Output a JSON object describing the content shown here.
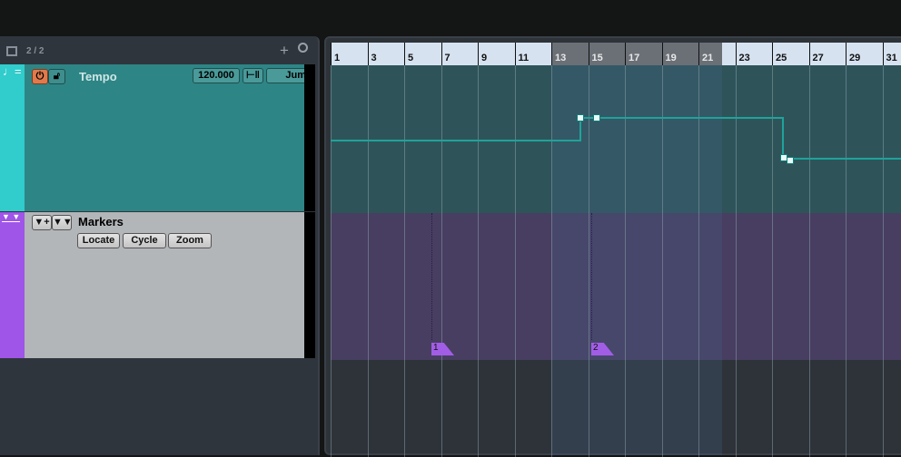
{
  "header": {
    "track_count": "2 / 2",
    "add_icon": "plus-icon",
    "search_icon": "search-icon"
  },
  "tempo_track": {
    "name": "Tempo",
    "tempo_value": "120.000",
    "mode_label": "Jum",
    "color": "#31cccc"
  },
  "marker_track": {
    "name": "Markers",
    "buttons": [
      "Locate",
      "Cycle",
      "Zoom"
    ],
    "color": "#9f55e8"
  },
  "ruler": {
    "bars": [
      "1",
      "3",
      "5",
      "7",
      "9",
      "11",
      "13",
      "15",
      "17",
      "19",
      "21",
      "23",
      "25",
      "27",
      "29",
      "31"
    ],
    "cycle_range": [
      "13",
      "21"
    ]
  },
  "markers": [
    {
      "label": "1"
    },
    {
      "label": "2"
    }
  ]
}
